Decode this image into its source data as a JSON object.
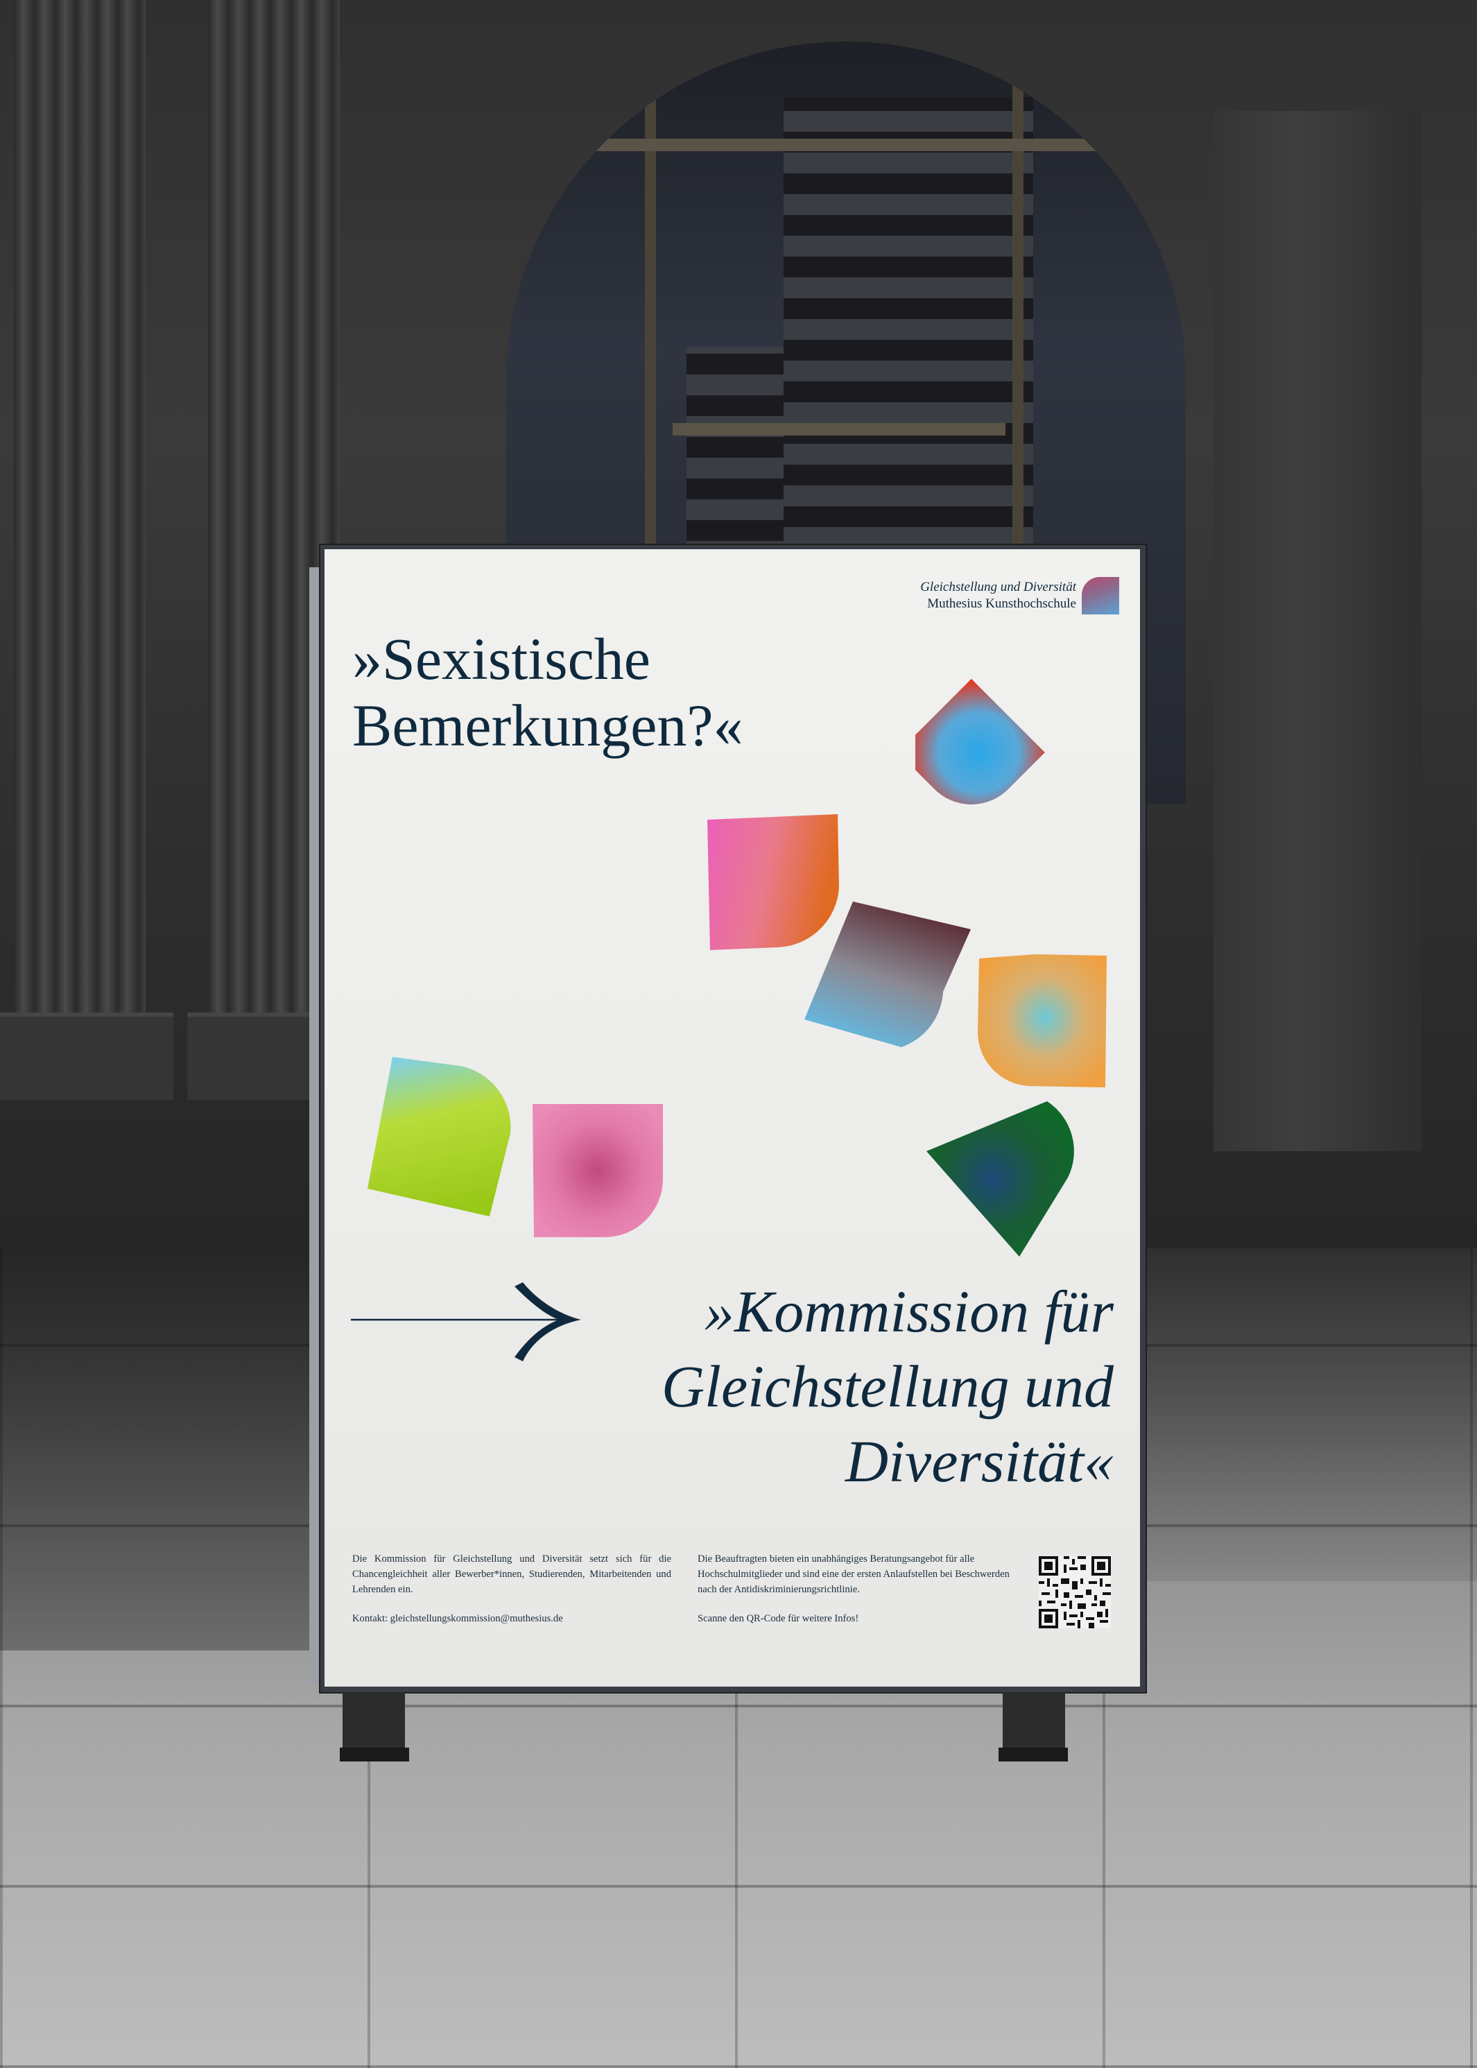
{
  "poster": {
    "logo": {
      "line1": "Gleichstellung und Diversität",
      "line2": "Muthesius Kunsthochschule"
    },
    "headline": "»Sexistische\nBemerkungen?«",
    "title": "»Kommission für\nGleichstellung und\nDiversität«",
    "info_left": {
      "text": "Die Kommission für Gleichstellung und Diversität setzt sich für die Chancengleichheit aller Bewerber*innen, Studierenden, Mitarbeitenden und Lehrenden ein.",
      "contact": "Kontakt: gleichstellungskommission@muthesius.de"
    },
    "info_right": {
      "text": "Die Beauftragten bieten ein unabhängiges Beratungsangebot für alle Hochschulmitglieder und sind eine der ersten Anlaufstellen bei Beschwerden nach der Antidiskriminierungsrichtlinie.",
      "cta": "Scanne den QR-Code für weitere Infos!"
    }
  },
  "colors": {
    "ink": "#0f2a3e",
    "paper": "#ececea"
  },
  "icons": [
    "arrow-icon",
    "qr-code-icon",
    "logo-mark-icon"
  ]
}
